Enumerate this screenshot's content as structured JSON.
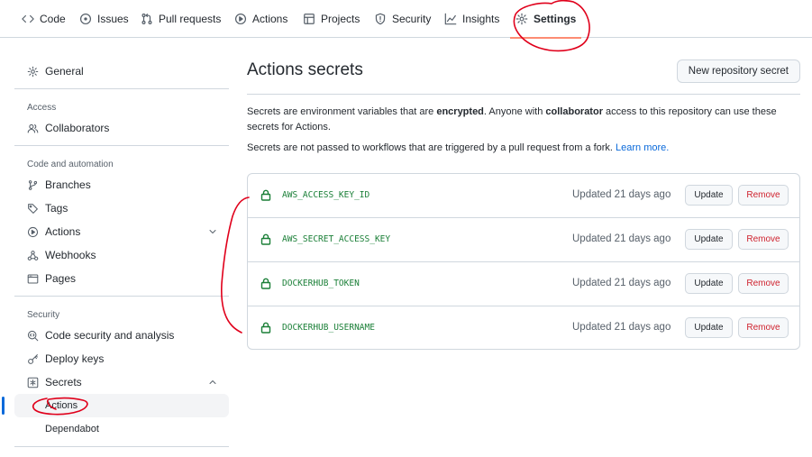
{
  "nav": {
    "tabs": [
      {
        "label": "Code",
        "icon": "code-icon"
      },
      {
        "label": "Issues",
        "icon": "issue-icon"
      },
      {
        "label": "Pull requests",
        "icon": "pull-request-icon"
      },
      {
        "label": "Actions",
        "icon": "play-icon"
      },
      {
        "label": "Projects",
        "icon": "table-icon"
      },
      {
        "label": "Security",
        "icon": "shield-icon"
      },
      {
        "label": "Insights",
        "icon": "graph-icon"
      },
      {
        "label": "Settings",
        "icon": "gear-icon",
        "active": true
      }
    ]
  },
  "sidebar": {
    "general": "General",
    "access_heading": "Access",
    "collaborators": "Collaborators",
    "code_heading": "Code and automation",
    "branches": "Branches",
    "tags": "Tags",
    "actions": "Actions",
    "webhooks": "Webhooks",
    "pages": "Pages",
    "security_heading": "Security",
    "code_security": "Code security and analysis",
    "deploy_keys": "Deploy keys",
    "secrets": "Secrets",
    "secrets_sub": [
      "Actions",
      "Dependabot"
    ]
  },
  "main": {
    "title": "Actions secrets",
    "new_button": "New repository secret",
    "desc1_a": "Secrets are environment variables that are ",
    "desc1_b": "encrypted",
    "desc1_c": ". Anyone with ",
    "desc1_d": "collaborator",
    "desc1_e": " access to this repository can use these secrets for Actions.",
    "desc2_a": "Secrets are not passed to workflows that are triggered by a pull request from a fork. ",
    "desc2_link": "Learn more.",
    "update_label": "Update",
    "remove_label": "Remove",
    "secrets": [
      {
        "name": "AWS_ACCESS_KEY_ID",
        "updated": "Updated 21 days ago"
      },
      {
        "name": "AWS_SECRET_ACCESS_KEY",
        "updated": "Updated 21 days ago"
      },
      {
        "name": "DOCKERHUB_TOKEN",
        "updated": "Updated 21 days ago"
      },
      {
        "name": "DOCKERHUB_USERNAME",
        "updated": "Updated 21 days ago"
      }
    ]
  },
  "colors": {
    "accent": "#0969da",
    "secret_green": "#1a7f37",
    "danger": "#cf222e",
    "annotation_red": "#e0001b"
  }
}
